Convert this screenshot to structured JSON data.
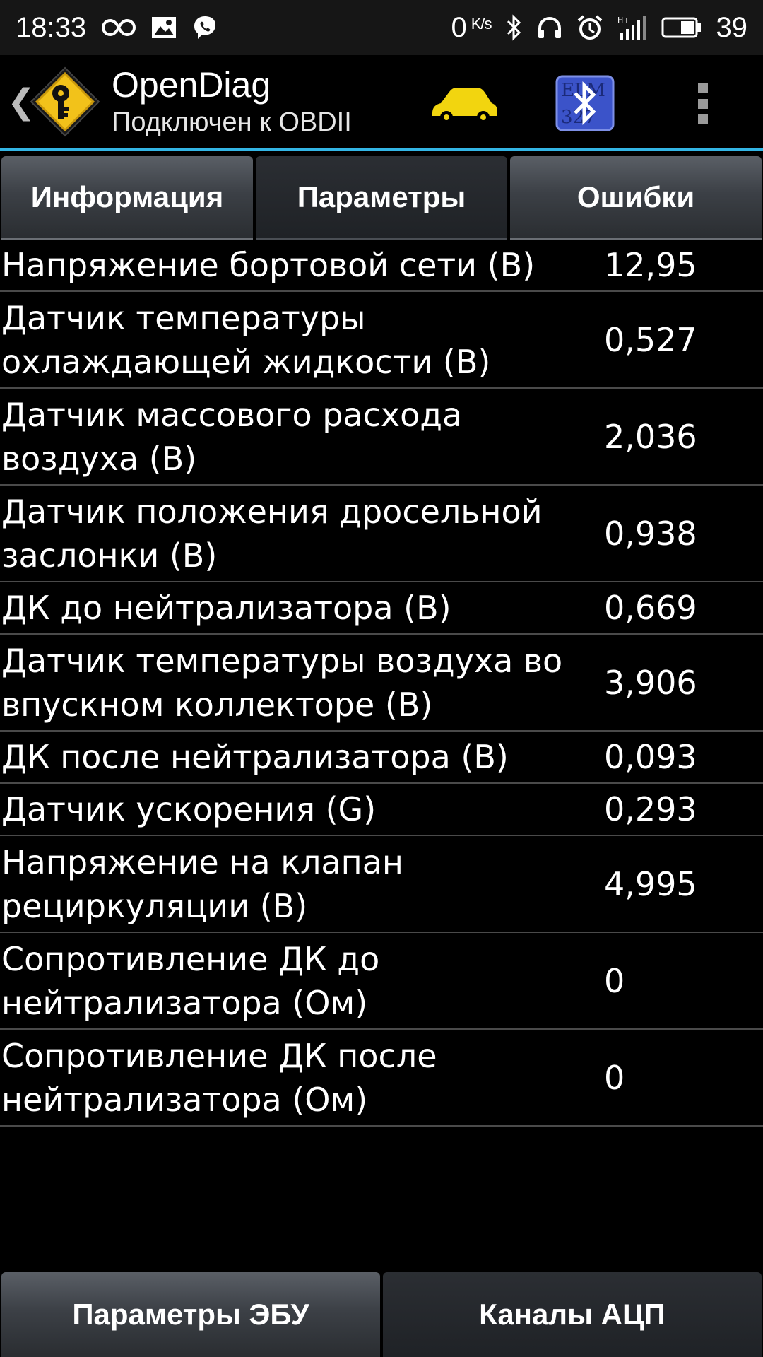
{
  "status_bar": {
    "time": "18:33",
    "net_speed_value": "0",
    "net_speed_unit": "K/s",
    "battery_percent": "39",
    "icons": [
      "infinity-icon",
      "gallery-icon",
      "viber-icon",
      "bluetooth-icon",
      "headphones-icon",
      "alarm-icon",
      "signal-icon",
      "battery-icon"
    ]
  },
  "action_bar": {
    "title": "OpenDiag",
    "subtitle": "Подключен к OBDII",
    "back_glyph": "❮",
    "accent_color": "#33b5e5"
  },
  "tabs": [
    {
      "label": "Информация",
      "active": false
    },
    {
      "label": "Параметры",
      "active": true
    },
    {
      "label": "Ошибки",
      "active": false
    }
  ],
  "params": [
    {
      "name": "Напряжение бортовой сети (В)",
      "value": "12,95"
    },
    {
      "name": "Датчик температуры охлаждающей жидкости (В)",
      "value": "0,527"
    },
    {
      "name": "Датчик массового расхода воздуха (В)",
      "value": "2,036"
    },
    {
      "name": "Датчик положения дросельной заслонки (В)",
      "value": "0,938"
    },
    {
      "name": "ДК до нейтрализатора (В)",
      "value": "0,669"
    },
    {
      "name": "Датчик температуры воздуха во впускном коллекторе (В)",
      "value": "3,906"
    },
    {
      "name": "ДК после нейтрализатора (В)",
      "value": "0,093"
    },
    {
      "name": "Датчик ускорения (G)",
      "value": "0,293"
    },
    {
      "name": "Напряжение на клапан рециркуляции (В)",
      "value": "4,995"
    },
    {
      "name": "Сопротивление ДК до нейтрализатора (Ом)",
      "value": "0"
    },
    {
      "name": "Сопротивление ДК после нейтрализатора (Ом)",
      "value": "0"
    }
  ],
  "bottom_buttons": [
    {
      "label": "Параметры ЭБУ",
      "active": false
    },
    {
      "label": "Каналы АЦП",
      "active": true
    }
  ]
}
